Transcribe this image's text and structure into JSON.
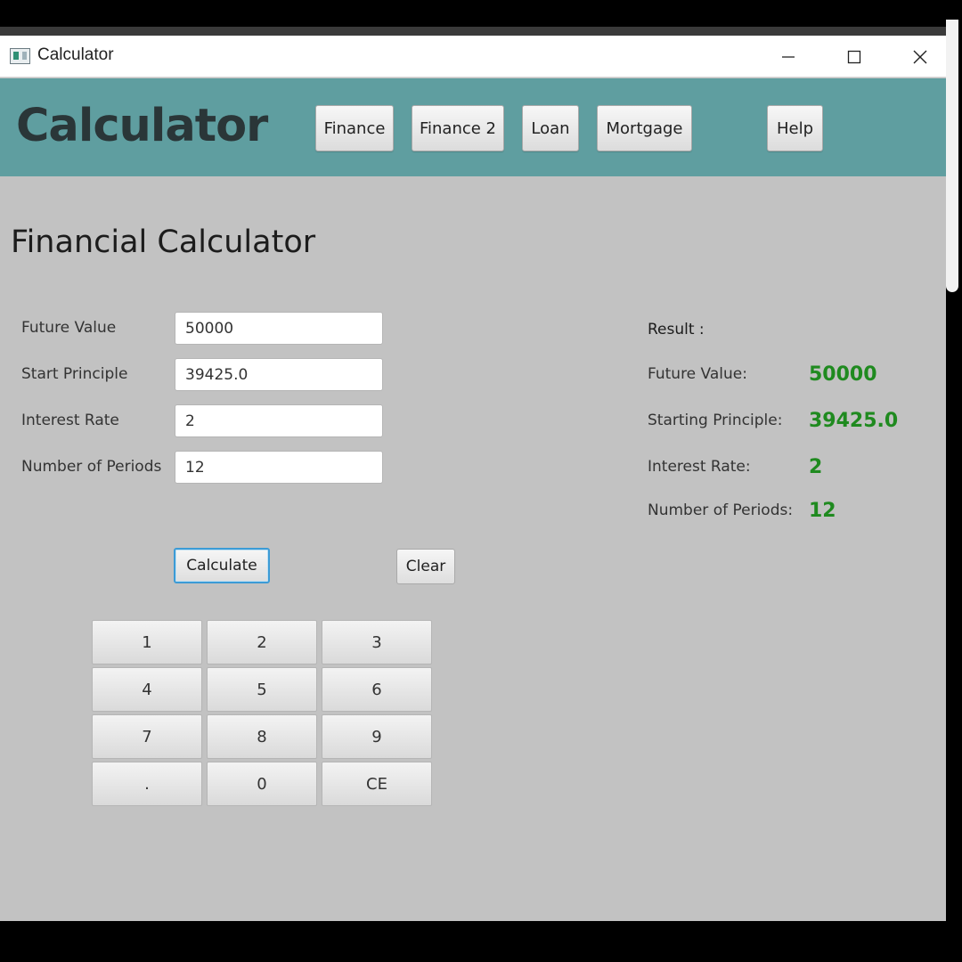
{
  "window": {
    "title": "Calculator"
  },
  "header": {
    "brand": "Calculator",
    "nav": [
      {
        "label": "Finance"
      },
      {
        "label": "Finance 2"
      },
      {
        "label": "Loan"
      },
      {
        "label": "Mortgage"
      },
      {
        "label": "Help"
      }
    ]
  },
  "main": {
    "title": "Financial Calculator",
    "fields": [
      {
        "label": "Future Value",
        "value": "50000"
      },
      {
        "label": "Start Principle",
        "value": "39425.0"
      },
      {
        "label": "Interest Rate",
        "value": "2"
      },
      {
        "label": "Number of Periods",
        "value": "12"
      }
    ],
    "calculate_label": "Calculate",
    "clear_label": "Clear",
    "keypad": [
      "1",
      "2",
      "3",
      "4",
      "5",
      "6",
      "7",
      "8",
      "9",
      ".",
      "0",
      "CE"
    ]
  },
  "result": {
    "heading": "Result :",
    "rows": [
      {
        "label": "Future Value:",
        "value": "50000"
      },
      {
        "label": "Starting Principle:",
        "value": "39425.0"
      },
      {
        "label": "Interest Rate:",
        "value": "2"
      },
      {
        "label": "Number of Periods:",
        "value": "12"
      }
    ]
  },
  "colors": {
    "header_bg": "#5f9ea0",
    "result_value": "#1f8a1f",
    "focus_ring": "#3c9bd6"
  },
  "icons": {
    "app": "app-window-icon",
    "minimize": "minimize-icon",
    "maximize": "maximize-icon",
    "close": "close-icon"
  }
}
